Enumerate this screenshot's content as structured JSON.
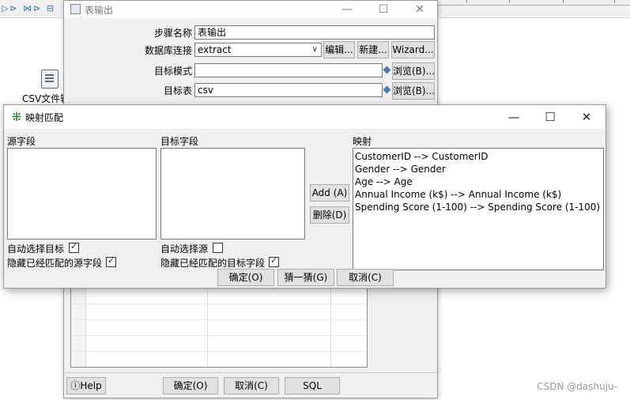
{
  "background": {
    "csv_label": "CSV文件输"
  },
  "table_output": {
    "title": "表输出",
    "step_name_label": "步骤名称",
    "step_name_value": "表输出",
    "db_conn_label": "数据库连接",
    "db_conn_value": "extract",
    "edit_btn": "编辑...",
    "new_btn": "新建...",
    "wizard_btn": "Wizard...",
    "target_schema_label": "目标模式",
    "target_schema_value": "",
    "browse_btn_1": "浏览(B)...",
    "target_table_label": "目标表",
    "target_table_value": "csv",
    "browse_btn_2": "浏览(B)...",
    "help_btn": "Help",
    "ok_btn": "确定(O)",
    "cancel_btn": "取消(C)",
    "sql_btn": "SQL"
  },
  "mapping": {
    "title": "映射匹配",
    "source_label": "源字段",
    "target_label": "目标字段",
    "mapping_label": "映射",
    "add_btn": "Add (A)",
    "delete_btn": "删除(D)",
    "auto_select_target_label": "自动选择目标",
    "auto_select_target_checked": true,
    "hide_matched_source_label": "隐藏已经匹配的源字段",
    "hide_matched_source_checked": true,
    "auto_select_source_label": "自动选择源",
    "auto_select_source_checked": false,
    "hide_matched_target_label": "隐藏已经匹配的目标字段",
    "hide_matched_target_checked": true,
    "ok_btn": "确定(O)",
    "guess_btn": "猜一猜(G)",
    "cancel_btn": "取消(C)",
    "mappings": [
      "CustomerID --> CustomerID",
      "Gender --> Gender",
      "Age --> Age",
      "Annual Income (k$) --> Annual Income (k$)",
      "Spending Score (1-100) --> Spending Score (1-100)"
    ]
  },
  "watermark": "CSDN @dashuju-"
}
